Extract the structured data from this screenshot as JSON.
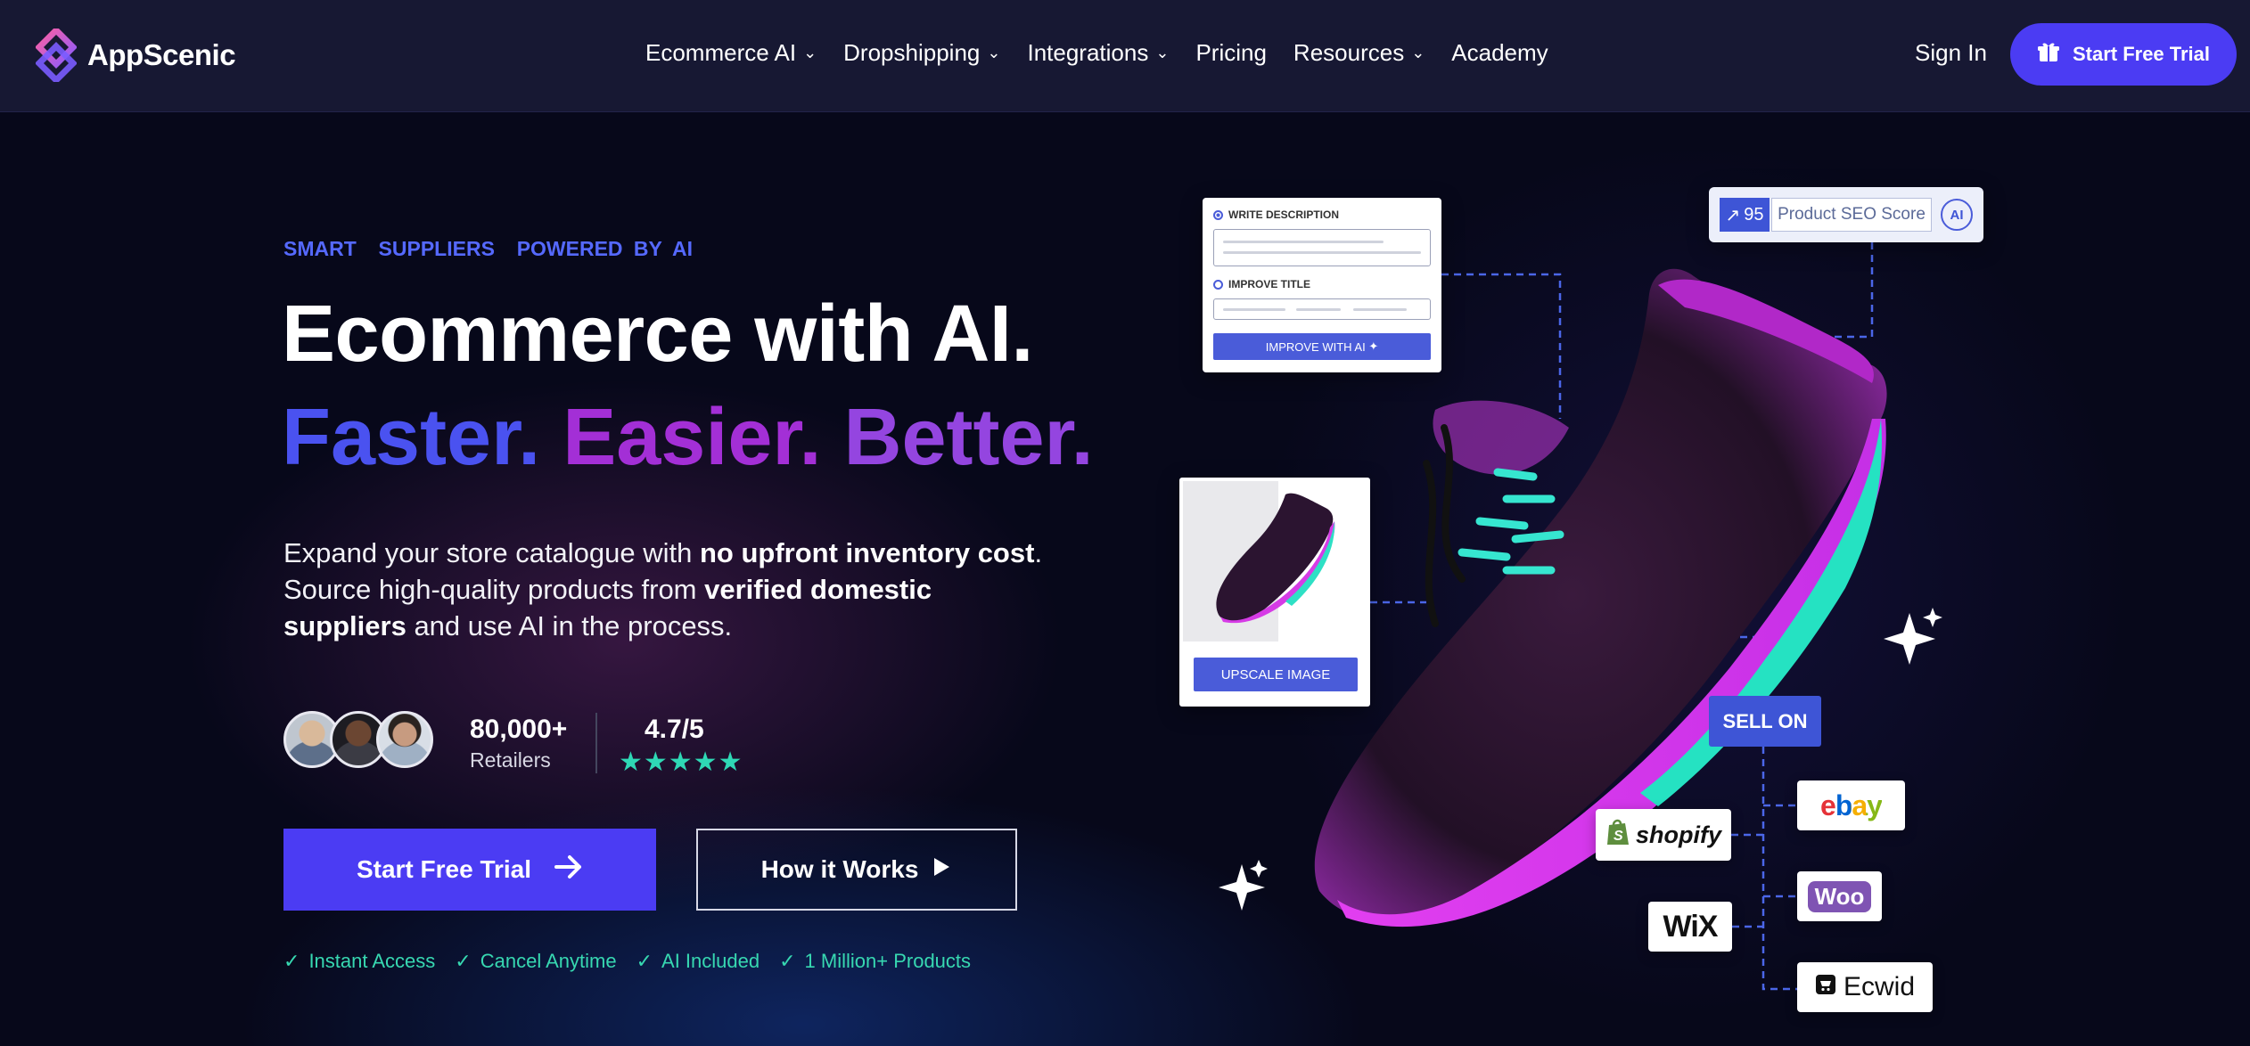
{
  "nav": {
    "brand": "AppScenic",
    "menu": [
      {
        "label": "Ecommerce AI",
        "has_dropdown": true
      },
      {
        "label": "Dropshipping",
        "has_dropdown": true
      },
      {
        "label": "Integrations",
        "has_dropdown": true
      },
      {
        "label": "Pricing",
        "has_dropdown": false
      },
      {
        "label": "Resources",
        "has_dropdown": true
      },
      {
        "label": "Academy",
        "has_dropdown": false
      }
    ],
    "sign_in": "Sign In",
    "cta": "Start Free Trial"
  },
  "hero": {
    "eyebrow": "SMART  SUPPLIERS  POWERED BY AI",
    "headline": "Ecommerce with AI.",
    "tagline": [
      "Faster.",
      "Easier.",
      "Better."
    ],
    "description": {
      "p1": "Expand your store catalogue with ",
      "b1": "no upfront inventory cost",
      "p2": ". Source high-quality products from ",
      "b2": "verified domestic suppliers",
      "p3": " and use AI in the process."
    },
    "stats": {
      "retailers_count": "80,000+",
      "retailers_label": "Retailers",
      "rating": "4.7/5",
      "stars": "★★★★★"
    },
    "primary_cta": "Start Free Trial",
    "secondary_cta": "How it Works",
    "checks": [
      "Instant Access",
      "Cancel Anytime",
      "AI Included",
      "1 Million+ Products"
    ]
  },
  "illustration": {
    "write_description": "WRITE DESCRIPTION",
    "improve_title": "IMPROVE TITLE",
    "improve_with_ai": "IMPROVE WITH AI",
    "seo_score": "95",
    "seo_label": "Product SEO Score",
    "seo_ai": "AI",
    "upscale_image": "UPSCALE IMAGE",
    "sell_on": "SELL ON",
    "platforms": {
      "shopify": "shopify",
      "wix": "WiX",
      "ebay": "ebay",
      "woo": "Woo",
      "ecwid": "Ecwid"
    }
  },
  "colors": {
    "background": "#07081a",
    "nav_bg": "#171833",
    "accent": "#4b3cf3",
    "eyebrow": "#5569ff",
    "check": "#37d8b1",
    "stars": "#2fd8b5"
  }
}
